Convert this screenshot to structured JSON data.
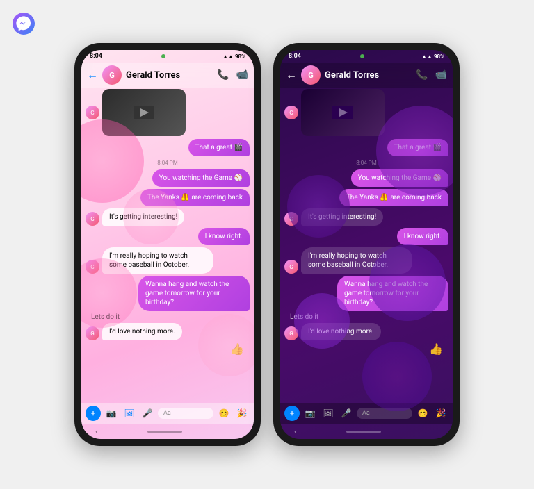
{
  "app": {
    "title": "Facebook Messenger"
  },
  "phone_light": {
    "status": {
      "time": "8:04",
      "signal": "▲▲▲",
      "battery": "98%"
    },
    "header": {
      "back": "←",
      "contact_name": "Gerald Torres",
      "call_icon": "📞",
      "video_icon": "📷"
    },
    "messages": [
      {
        "type": "sent",
        "text": "That a great 🎬"
      },
      {
        "type": "timestamp",
        "text": "8:04 PM"
      },
      {
        "type": "sent",
        "text": "You watching the Game ⚾"
      },
      {
        "type": "sent",
        "text": "The Yanks 🦺 are coming back"
      },
      {
        "type": "received",
        "text": "It's getting interesting!"
      },
      {
        "type": "sent",
        "text": "I know right."
      },
      {
        "type": "received",
        "text": "I'm really hoping to watch some baseball in October."
      },
      {
        "type": "sent",
        "text": "Wanna hang and watch the game tomorrow for your birthday?"
      },
      {
        "type": "received_plain",
        "text": "Lets do it"
      },
      {
        "type": "received",
        "text": "I'd love nothing more."
      },
      {
        "type": "emoji",
        "text": "👍"
      }
    ],
    "input": {
      "placeholder": "Aa"
    }
  },
  "phone_dark": {
    "status": {
      "time": "8:04",
      "signal": "▲▲▲",
      "battery": "98%"
    },
    "header": {
      "back": "←",
      "contact_name": "Gerald Torres",
      "call_icon": "📞",
      "video_icon": "📷"
    },
    "messages": [
      {
        "type": "sent",
        "text": "That a great 🎬"
      },
      {
        "type": "timestamp",
        "text": "8:04 PM"
      },
      {
        "type": "sent",
        "text": "You watching the Game ⚾"
      },
      {
        "type": "sent",
        "text": "The Yanks 🦺 are coming back"
      },
      {
        "type": "received",
        "text": "It's getting interesting!"
      },
      {
        "type": "sent",
        "text": "I know right."
      },
      {
        "type": "received",
        "text": "I'm really hoping to watch some baseball in October."
      },
      {
        "type": "sent",
        "text": "Wanna hang and watch the game tomorrow for your birthday?"
      },
      {
        "type": "received_plain",
        "text": "Lets do it"
      },
      {
        "type": "received",
        "text": "I'd love nothing more."
      },
      {
        "type": "emoji",
        "text": "👍"
      }
    ],
    "input": {
      "placeholder": "Aa"
    }
  }
}
